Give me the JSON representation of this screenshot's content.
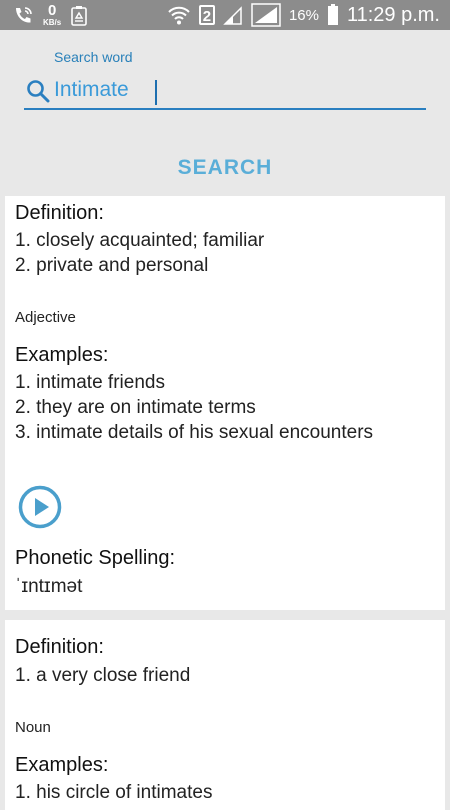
{
  "status_bar": {
    "data_rate_value": "0",
    "data_rate_unit": "KB/s",
    "sim_slot": "2",
    "battery_percent": "16%",
    "time": "11:29 p.m."
  },
  "search": {
    "label": "Search word",
    "value": "Intimate",
    "button_label": "SEARCH"
  },
  "results": [
    {
      "definition_heading": "Definition:",
      "definitions": [
        "1. closely acquainted; familiar",
        "2. private and personal"
      ],
      "part_of_speech": "Adjective",
      "examples_heading": "Examples:",
      "examples": [
        "1. intimate friends",
        "2. they are on intimate terms",
        "3. intimate details of his sexual encounters"
      ],
      "phonetic_heading": "Phonetic Spelling:",
      "phonetic": "ˈɪntɪmət"
    },
    {
      "definition_heading": "Definition:",
      "definitions": [
        "1. a very close friend"
      ],
      "part_of_speech": "Noun",
      "examples_heading": "Examples:",
      "examples": [
        "1. his circle of intimates"
      ]
    }
  ],
  "colors": {
    "accent": "#2a7fc0",
    "search_text": "#3a9ad9",
    "button_text": "#5aaed8",
    "play_icon": "#4a9fcc",
    "background": "#e8e8e8",
    "status_bar": "#8c8c8c"
  }
}
